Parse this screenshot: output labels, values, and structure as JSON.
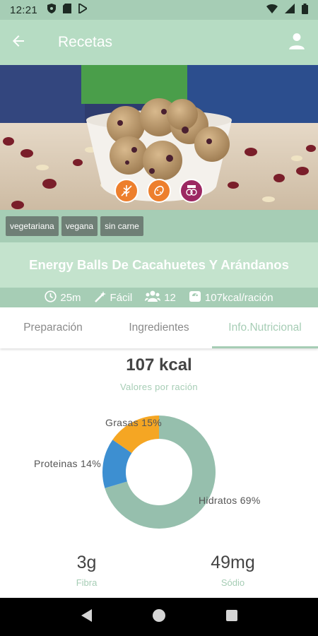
{
  "status_bar": {
    "time": "12:21"
  },
  "app_bar": {
    "title": "Recetas"
  },
  "hero": {
    "badge_icons": [
      "gluten-free-icon",
      "nuts-icon",
      "allergen-icon"
    ]
  },
  "tags": [
    "vegetariana",
    "vegana",
    "sin carne"
  ],
  "recipe": {
    "title": "Energy Balls De Cacahuetes Y Arándanos",
    "time": "25m",
    "difficulty": "Fácil",
    "servings": "12",
    "kcal_per_serving": "107kcal/ración"
  },
  "tabs": [
    {
      "label": "Preparación",
      "active": false
    },
    {
      "label": "Ingredientes",
      "active": false
    },
    {
      "label": "Info.Nutricional",
      "active": true
    }
  ],
  "nutrition": {
    "kcal": "107 kcal",
    "subtitle": "Valores por ración",
    "macros": [
      {
        "label": "Grasas 15%",
        "percent": 15,
        "color": "#f5a623"
      },
      {
        "label": "Proteinas 14%",
        "percent": 14,
        "color": "#3d8fd1"
      },
      {
        "label": "Hidratos 69%",
        "percent": 69,
        "color": "#96bfad"
      }
    ],
    "stats": [
      {
        "value": "3g",
        "label": "Fibra"
      },
      {
        "value": "49mg",
        "label": "Sódio"
      }
    ]
  },
  "colors": {
    "accent": "#a6cdb5",
    "accent_light": "#c4e3cd"
  }
}
